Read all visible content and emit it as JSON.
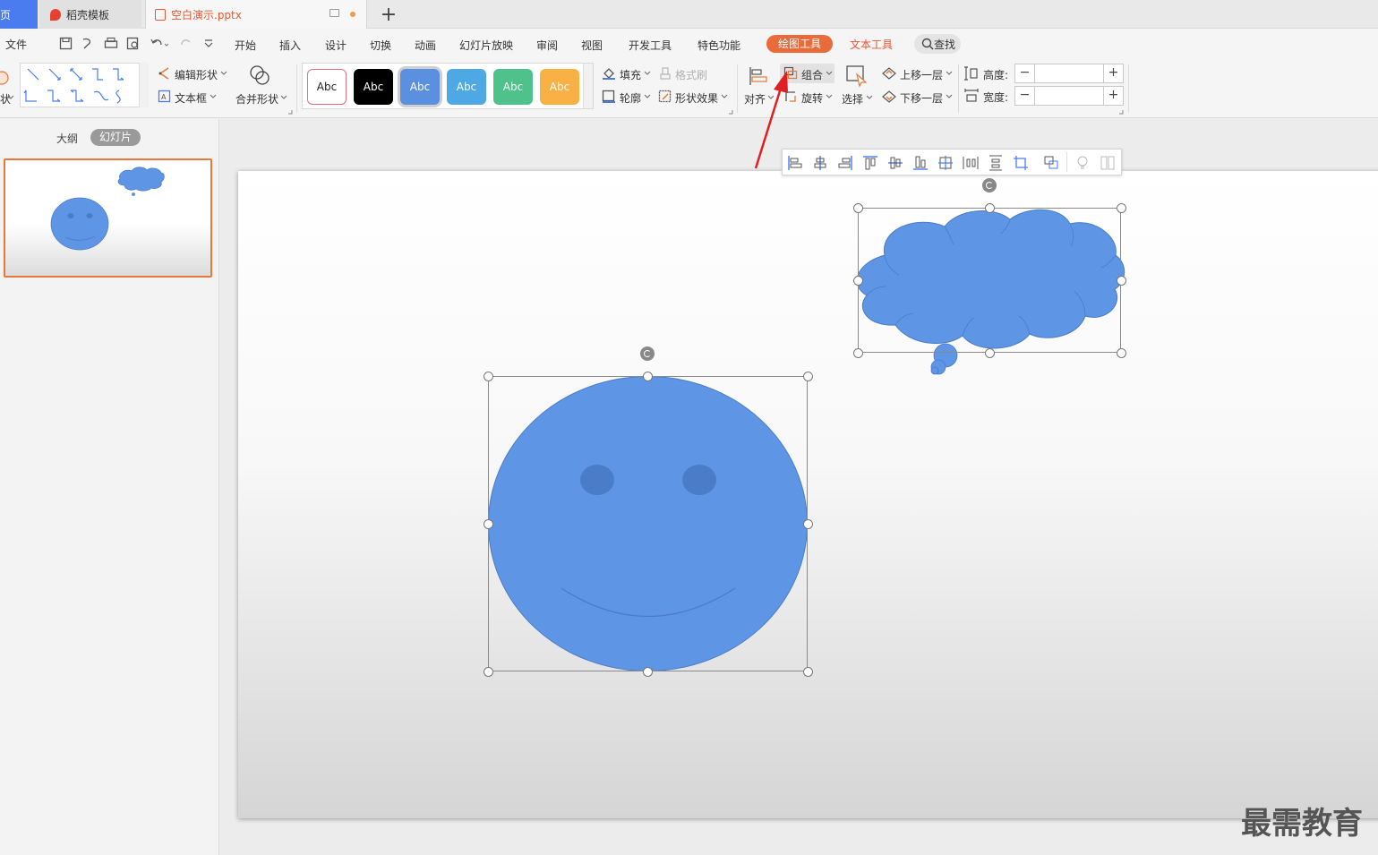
{
  "tabs": {
    "home": "首页",
    "template": "稻壳模板",
    "file": "空白演示.pptx"
  },
  "menu": {
    "file": "文件",
    "items": [
      "开始",
      "插入",
      "设计",
      "切换",
      "动画",
      "幻灯片放映",
      "审阅",
      "视图",
      "开发工具",
      "特色功能"
    ],
    "drawing_tools": "绘图工具",
    "text_tools": "文本工具",
    "search": "查找"
  },
  "ribbon": {
    "shape_label": "状",
    "edit_shape": "编辑形状",
    "textbox": "文本框",
    "merge_shapes": "合并形状",
    "style_sample": "Abc",
    "fill": "填充",
    "format_painter": "格式刷",
    "outline": "轮廓",
    "shape_effects": "形状效果",
    "align": "对齐",
    "group": "组合",
    "rotate": "旋转",
    "select": "选择",
    "bring_forward": "上移一层",
    "send_backward": "下移一层",
    "height_label": "高度:",
    "width_label": "宽度:",
    "minus": "−",
    "plus": "+"
  },
  "style_colors": [
    "#ffffff",
    "#000000",
    "#5b8fe0",
    "#4ea8e4",
    "#4fc18a",
    "#f9b045"
  ],
  "left_panel": {
    "outline_tab": "大纲",
    "slides_tab": "幻灯片"
  },
  "colors": {
    "shape_fill": "#5e95e5",
    "shape_stroke": "#4b7cc8",
    "accent": "#ea6b3a",
    "arrow": "#e02020"
  },
  "float_toolbar_icons": [
    "align-left-icon",
    "align-center-icon",
    "align-right-icon",
    "align-top-icon",
    "align-middle-icon",
    "align-bottom-icon",
    "align-grid-icon",
    "distribute-horizontal-icon",
    "distribute-vertical-icon",
    "crop-icon",
    "group-icon",
    "bulb-icon",
    "columns-icon"
  ],
  "watermark": "最需教育"
}
